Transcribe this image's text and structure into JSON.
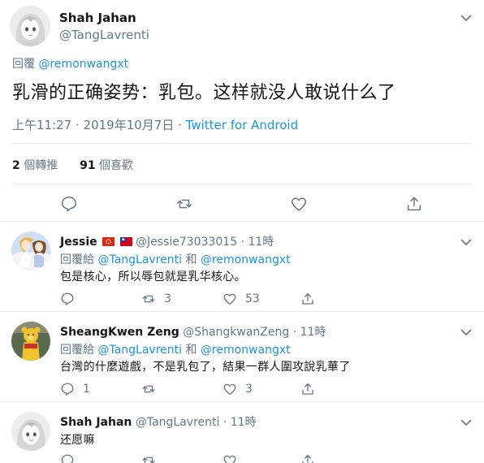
{
  "main_tweet": {
    "name": "Shah Jahan",
    "handle": "@TangLavrenti",
    "reply_prefix": "回覆",
    "reply_to": "@remonwangxt",
    "text": "乳滑的正确姿势：乳包。这样就没人敢说什么了",
    "timestamp": "上午11:27 · 2019年10月7日",
    "sep": " · ",
    "source": "Twitter for Android",
    "retweets_count": "2",
    "retweets_label": "個轉推",
    "likes_count": "91",
    "likes_label": "個喜歡"
  },
  "replies": [
    {
      "name": "Jessie",
      "flags": [
        "hong-kong-flag",
        "taiwan-flag"
      ],
      "handle": "@Jessie73033015",
      "time": "· 11時",
      "reply_prefix": "回覆給",
      "reply_to_1": "@TangLavrenti",
      "and": "和",
      "reply_to_2": "@remonwangxt",
      "text": "包是核心，所以辱包就是乳华核心。",
      "replies_count": "",
      "retweets_count": "3",
      "likes_count": "53"
    },
    {
      "name": "SheangKwen Zeng",
      "handle": "@ShangkwanZeng",
      "time": "· 11時",
      "reply_prefix": "回覆給",
      "reply_to_1": "@TangLavrenti",
      "and": "和",
      "reply_to_2": "@remonwangxt",
      "text": "台灣的什麼遊戲，不是乳包了，結果一群人圍攻說乳華了",
      "replies_count": "1",
      "retweets_count": "",
      "likes_count": "3"
    },
    {
      "name": "Shah Jahan",
      "handle": "@TangLavrenti",
      "time": "· 11時",
      "text": "还愿嘛"
    }
  ],
  "colors": {
    "link": "#1b95e0",
    "muted": "#657786",
    "text": "#14171a",
    "divider": "#e6ecf0"
  }
}
